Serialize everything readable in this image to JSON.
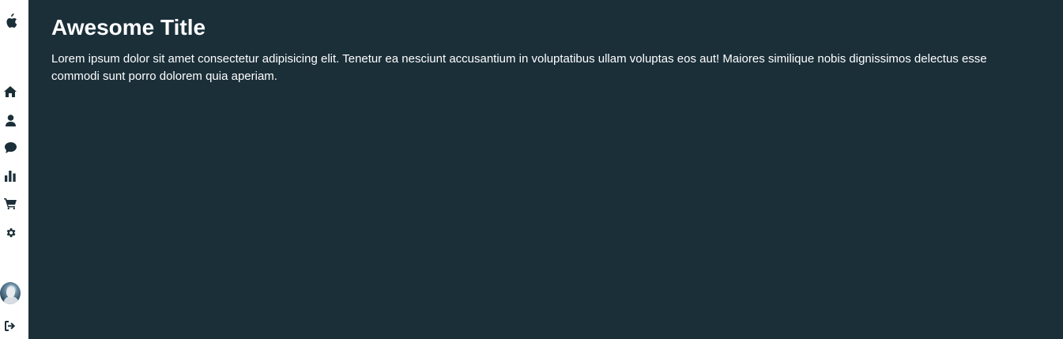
{
  "app": {
    "title": "Awesome Title",
    "body": "Lorem ipsum dolor sit amet consectetur adipisicing elit. Tenetur ea nesciunt accusantium in voluptatibus ullam voluptas eos aut! Maiores similique nobis dignissimos delectus esse commodi sunt porro dolorem quia aperiam."
  },
  "sidebar": {
    "logo_icon": "apple-icon",
    "items": [
      {
        "icon": "home-icon"
      },
      {
        "icon": "user-icon"
      },
      {
        "icon": "comment-icon"
      },
      {
        "icon": "bar-chart-icon"
      },
      {
        "icon": "shopping-cart-icon"
      },
      {
        "icon": "gear-icon"
      }
    ],
    "logout_icon": "sign-out-icon"
  },
  "colors": {
    "background": "#1b2f39",
    "sidebar": "#ffffff",
    "icon": "#1b2f39",
    "text": "#ffffff"
  }
}
